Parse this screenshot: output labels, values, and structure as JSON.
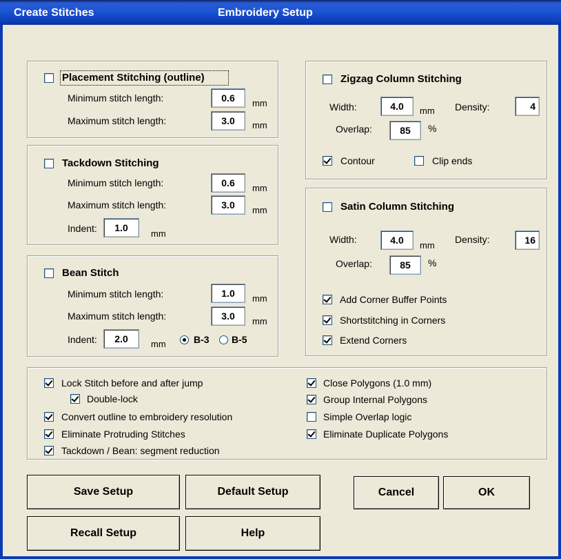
{
  "window": {
    "title_left": "Create Stitches",
    "title_center": "Embroidery Setup"
  },
  "placement": {
    "label": "Placement Stitching (outline)",
    "checked": false,
    "min_label": "Minimum stitch length:",
    "min_value": "0.6",
    "max_label": "Maximum stitch length:",
    "max_value": "3.0",
    "unit": "mm"
  },
  "tackdown": {
    "label": "Tackdown Stitching",
    "checked": false,
    "min_label": "Minimum stitch length:",
    "min_value": "0.6",
    "max_label": "Maximum stitch length:",
    "max_value": "3.0",
    "indent_label": "Indent:",
    "indent_value": "1.0",
    "unit": "mm"
  },
  "bean": {
    "label": "Bean Stitch",
    "checked": false,
    "min_label": "Minimum stitch length:",
    "min_value": "1.0",
    "max_label": "Maximum stitch length:",
    "max_value": "3.0",
    "indent_label": "Indent:",
    "indent_value": "2.0",
    "unit": "mm",
    "radio_b3": "B-3",
    "radio_b5": "B-5",
    "selected": "B-3"
  },
  "zigzag": {
    "label": "Zigzag Column Stitching",
    "checked": false,
    "width_label": "Width:",
    "width_value": "4.0",
    "width_unit": "mm",
    "density_label": "Density:",
    "density_value": "4",
    "overlap_label": "Overlap:",
    "overlap_value": "85",
    "overlap_unit": "%",
    "contour_label": "Contour",
    "contour_checked": true,
    "clip_label": "Clip ends",
    "clip_checked": false
  },
  "satin": {
    "label": "Satin Column Stitching",
    "checked": false,
    "width_label": "Width:",
    "width_value": "4.0",
    "width_unit": "mm",
    "density_label": "Density:",
    "density_value": "16",
    "overlap_label": "Overlap:",
    "overlap_value": "85",
    "overlap_unit": "%",
    "corner_buffer_label": "Add Corner Buffer Points",
    "corner_buffer_checked": true,
    "shortstitch_label": "Shortstitching in Corners",
    "shortstitch_checked": true,
    "extend_label": "Extend Corners",
    "extend_checked": true
  },
  "options": {
    "lock_stitch_label": "Lock Stitch before and after jump",
    "lock_stitch_checked": true,
    "double_lock_label": "Double-lock",
    "double_lock_checked": true,
    "convert_label": "Convert outline to embroidery resolution",
    "convert_checked": true,
    "eliminate_protruding_label": "Eliminate Protruding Stitches",
    "eliminate_protruding_checked": true,
    "segment_reduction_label": "Tackdown / Bean:  segment reduction",
    "segment_reduction_checked": true,
    "close_polygons_label": "Close Polygons (1.0 mm)",
    "close_polygons_checked": true,
    "group_internal_label": "Group Internal Polygons",
    "group_internal_checked": true,
    "simple_overlap_label": "Simple Overlap logic",
    "simple_overlap_checked": false,
    "eliminate_duplicate_label": "Eliminate Duplicate Polygons",
    "eliminate_duplicate_checked": true
  },
  "buttons": {
    "save": "Save Setup",
    "default": "Default Setup",
    "cancel": "Cancel",
    "ok": "OK",
    "recall": "Recall Setup",
    "help": "Help"
  },
  "colors": {
    "title_bar": "#0b3bb3",
    "dialog_bg": "#ece9d8"
  }
}
